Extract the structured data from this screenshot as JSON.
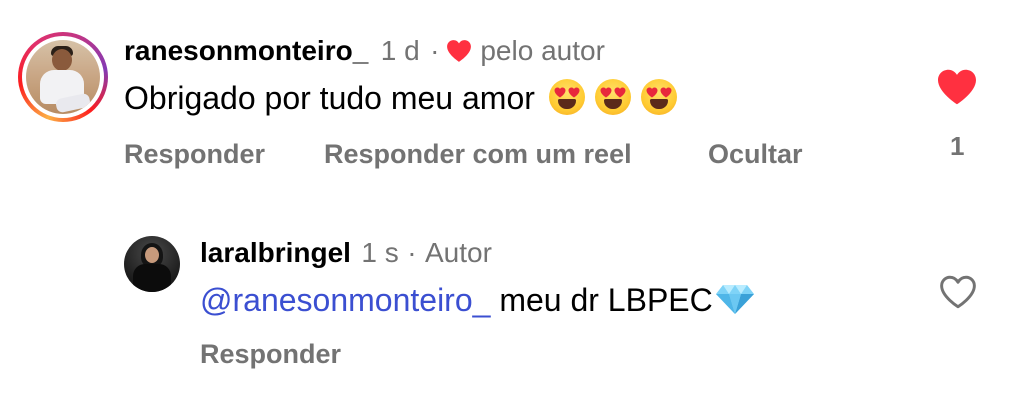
{
  "comments": [
    {
      "username": "ranesonmonteiro_",
      "time": "1 d",
      "separator": "·",
      "liked_by_label": "pelo autor",
      "text": "Obrigado por tudo meu amor",
      "emoji_names": [
        "heart-eyes-emoji",
        "heart-eyes-emoji",
        "heart-eyes-emoji"
      ],
      "actions": {
        "reply": "Responder",
        "reply_reel": "Responder com um reel",
        "hide": "Ocultar"
      },
      "like_count": "1",
      "liked": true
    },
    {
      "username": "laralbringel",
      "time": "1 s",
      "separator": "·",
      "author_label": "Autor",
      "mention": "@ranesonmonteiro_",
      "text": "meu dr LBPEC",
      "emoji_name": "gem-emoji",
      "actions": {
        "reply": "Responder"
      },
      "liked": false
    }
  ],
  "colors": {
    "like_red": "#ff3040",
    "meta_gray": "#737373",
    "mention_blue": "#3b4fd1"
  }
}
